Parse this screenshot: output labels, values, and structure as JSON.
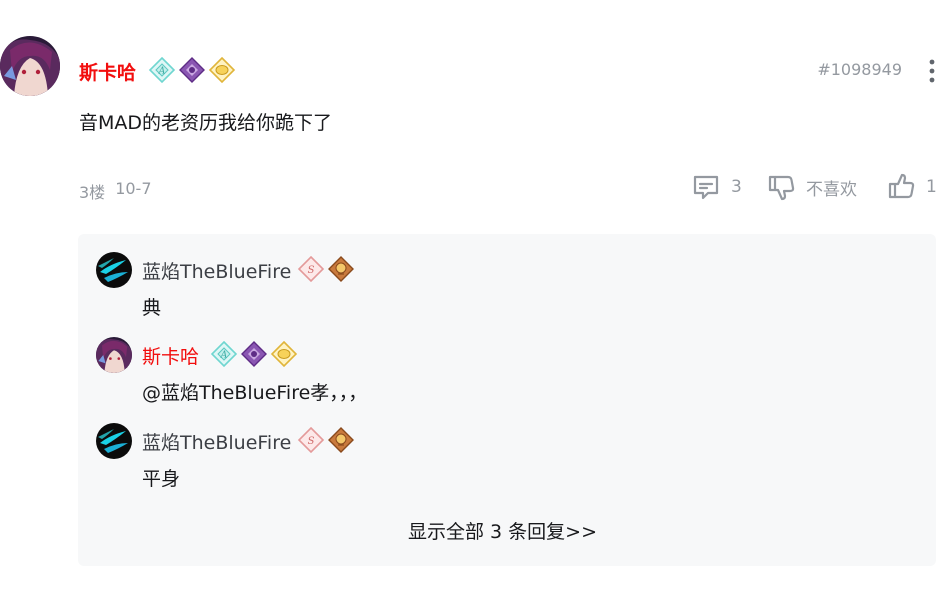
{
  "comment": {
    "author": "斯卡哈",
    "post_id": "#1098949",
    "content": "音MAD的老资历我给你跪下了",
    "floor": "3楼",
    "date": "10-7",
    "reply_count": "3",
    "dislike_label": "不喜欢",
    "like_count": "1",
    "author_color": "#f20e0e"
  },
  "replies": [
    {
      "author": "蓝焰TheBlueFire",
      "text": "典",
      "author_color": "#3c3f45"
    },
    {
      "author": "斯卡哈",
      "text": "@蓝焰TheBlueFire孝，，，",
      "author_color": "#f20e0e"
    },
    {
      "author": "蓝焰TheBlueFire",
      "text": "平身",
      "author_color": "#3c3f45"
    }
  ],
  "show_all_label": "显示全部 3 条回复>>",
  "icons": {
    "reply": "comment-icon",
    "dislike": "thumbs-down-icon",
    "like": "thumbs-up-icon",
    "more": "more-vertical-icon"
  }
}
